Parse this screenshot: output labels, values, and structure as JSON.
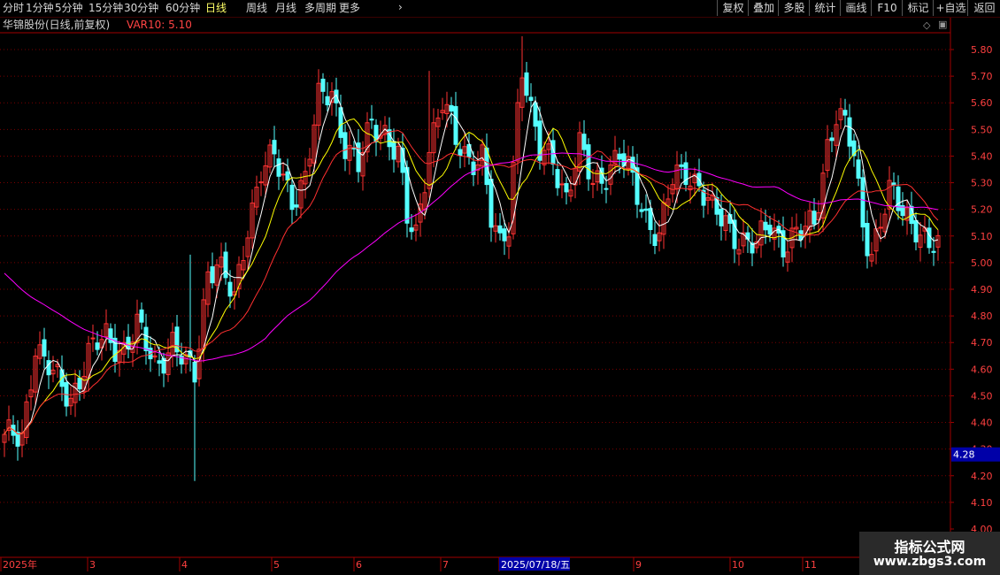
{
  "period_tabs": [
    "分时",
    "1分钟",
    "5分钟",
    "15分钟",
    "30分钟",
    "60分钟",
    "日线",
    "周线",
    "月线",
    "多周期",
    "更多"
  ],
  "active_tab": "日线",
  "right_buttons": [
    "复权",
    "叠加",
    "多股",
    "统计",
    "画线",
    "F10",
    "标记",
    "+自选",
    "返回"
  ],
  "title": "华锦股份(日线,前复权)",
  "indicator": "VAR10: 5.10",
  "price_axis": {
    "labels": [
      "5.80",
      "5.70",
      "5.60",
      "5.50",
      "5.40",
      "5.30",
      "5.20",
      "5.10",
      "5.00",
      "4.90",
      "4.80",
      "4.70",
      "4.60",
      "4.50",
      "4.40",
      "4.30",
      "4.20",
      "4.10",
      "4.00"
    ],
    "highlight": "4.28"
  },
  "date_axis": [
    "2025年",
    "3",
    "4",
    "5",
    "6",
    "7",
    "2025/07/18/五",
    "9",
    "10",
    "11"
  ],
  "watermark": {
    "line1": "指标公式网",
    "line2": "www.zbgs3.com"
  },
  "colors": {
    "up": "#ff3232",
    "down": "#54ffff",
    "ma5": "#ffffff",
    "ma10": "#ffff00",
    "ma20": "#ff3030",
    "ma60": "#ff00ff",
    "highlight_bg": "#0000a8"
  },
  "chart_data": {
    "type": "candlestick",
    "y_range": [
      4.0,
      5.85
    ],
    "ma_periods": [
      5,
      10,
      20,
      60
    ],
    "anchors_close": [
      [
        0,
        4.33
      ],
      [
        4,
        4.35
      ],
      [
        7,
        4.7
      ],
      [
        9,
        4.62
      ],
      [
        12,
        4.55
      ],
      [
        15,
        4.5
      ],
      [
        19,
        4.65
      ],
      [
        23,
        4.72
      ],
      [
        27,
        4.68
      ],
      [
        30,
        4.75
      ],
      [
        34,
        4.62
      ],
      [
        38,
        4.7
      ],
      [
        41,
        4.6
      ],
      [
        43,
        4.58
      ],
      [
        46,
        4.98
      ],
      [
        48,
        5.0
      ],
      [
        52,
        4.85
      ],
      [
        55,
        5.15
      ],
      [
        58,
        5.35
      ],
      [
        61,
        5.38
      ],
      [
        65,
        5.25
      ],
      [
        68,
        5.32
      ],
      [
        71,
        5.6
      ],
      [
        74,
        5.65
      ],
      [
        77,
        5.45
      ],
      [
        80,
        5.35
      ],
      [
        83,
        5.52
      ],
      [
        86,
        5.5
      ],
      [
        89,
        5.4
      ],
      [
        91,
        5.15
      ],
      [
        93,
        5.1
      ],
      [
        96,
        5.45
      ],
      [
        99,
        5.6
      ],
      [
        102,
        5.45
      ],
      [
        105,
        5.4
      ],
      [
        108,
        5.4
      ],
      [
        110,
        5.15
      ],
      [
        112,
        5.05
      ],
      [
        114,
        5.15
      ],
      [
        116,
        5.6
      ],
      [
        117,
        5.75
      ],
      [
        119,
        5.55
      ],
      [
        121,
        5.4
      ],
      [
        124,
        5.4
      ],
      [
        127,
        5.25
      ],
      [
        130,
        5.42
      ],
      [
        133,
        5.3
      ],
      [
        136,
        5.35
      ],
      [
        139,
        5.4
      ],
      [
        142,
        5.3
      ],
      [
        145,
        5.18
      ],
      [
        148,
        5.1
      ],
      [
        151,
        5.3
      ],
      [
        154,
        5.35
      ],
      [
        157,
        5.3
      ],
      [
        160,
        5.18
      ],
      [
        163,
        5.15
      ],
      [
        166,
        5.1
      ],
      [
        170,
        5.05
      ],
      [
        173,
        5.15
      ],
      [
        176,
        5.08
      ],
      [
        180,
        5.1
      ],
      [
        183,
        5.15
      ],
      [
        186,
        5.45
      ],
      [
        188,
        5.55
      ],
      [
        190,
        5.5
      ],
      [
        192,
        5.4
      ],
      [
        194,
        5.15
      ],
      [
        196,
        5.05
      ],
      [
        198,
        5.15
      ],
      [
        200,
        5.25
      ],
      [
        203,
        5.2
      ],
      [
        206,
        5.15
      ],
      [
        209,
        5.05
      ],
      [
        211,
        5.05
      ]
    ]
  }
}
